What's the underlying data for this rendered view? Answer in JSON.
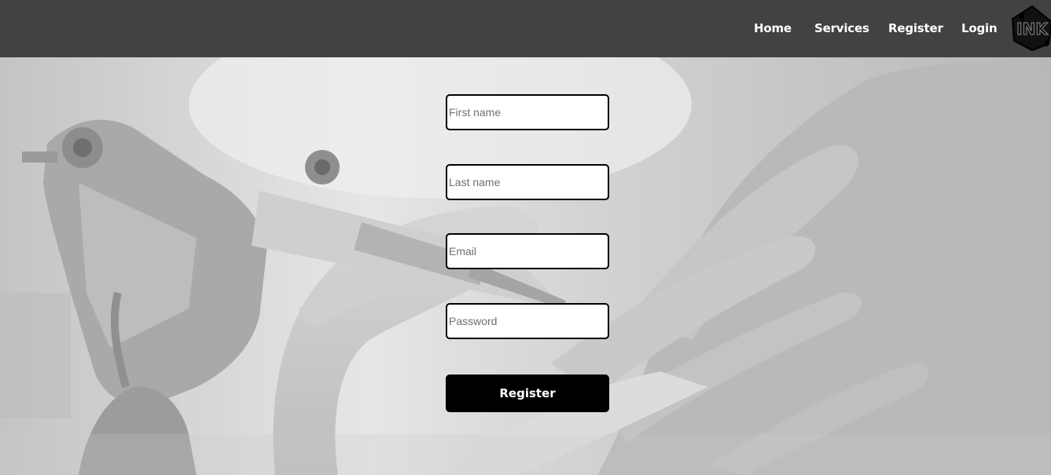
{
  "nav": {
    "home": "Home",
    "services": "Services",
    "register": "Register",
    "login": "Login"
  },
  "logo": {
    "text": "INK"
  },
  "form": {
    "first_name_placeholder": "First name",
    "last_name_placeholder": "Last name",
    "email_placeholder": "Email",
    "password_placeholder": "Password",
    "submit_label": "Register"
  },
  "colors": {
    "header_bg": "#424242",
    "button_bg": "#000000",
    "field_border": "#000000"
  }
}
